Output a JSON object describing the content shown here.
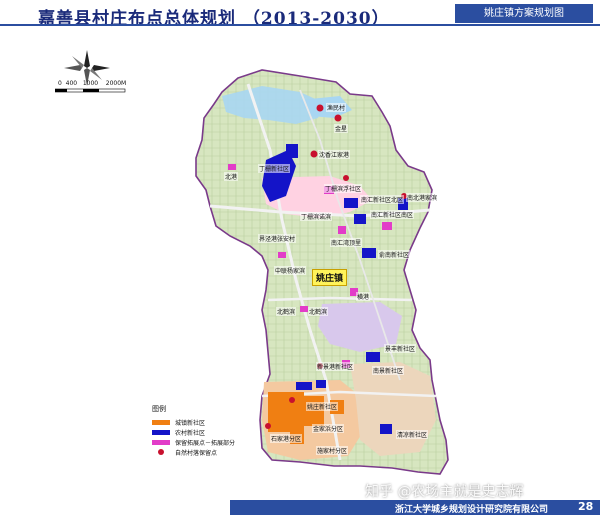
{
  "title": "嘉善县村庄布点总体规划 （2013-2030）",
  "subtitle": "姚庄镇方案规划图",
  "town_label": "姚庄镇",
  "scale": {
    "labels": [
      "0",
      "400",
      "1000",
      "2000M"
    ]
  },
  "legend": {
    "title": "图例",
    "items": [
      {
        "label": "城镇新社区",
        "color": "#f07f12"
      },
      {
        "label": "农村新社区",
        "color": "#1414c8"
      },
      {
        "label": "保留拓展点－拓展部分",
        "color": "#e23cc8"
      },
      {
        "label": "自然村落保留点",
        "color": "#c8102e"
      }
    ]
  },
  "place_labels": [
    "渔民村",
    "金星",
    "沈香江家港",
    "北港",
    "丁栅新社区",
    "丁栅滨浮社区",
    "南汇新社区北区",
    "丁栅滨诺滨",
    "南北港家滨",
    "南汇新社区南区",
    "界泾港张安村",
    "南汇湾顶里",
    "俞南新社区",
    "中联杨家滨",
    "横港",
    "北鹤滨",
    "北鹤滨",
    "新景港新社区",
    "南景新社区",
    "景丰新社区",
    "姚庄新社区",
    "石家港分区",
    "金家浜分区",
    "清凉新社区",
    "施家村分区"
  ],
  "footer": {
    "org": "浙江大学城乡规划设计研究院有限公司",
    "page": "28"
  },
  "watermark": "知乎 @农场主就是史志辉"
}
